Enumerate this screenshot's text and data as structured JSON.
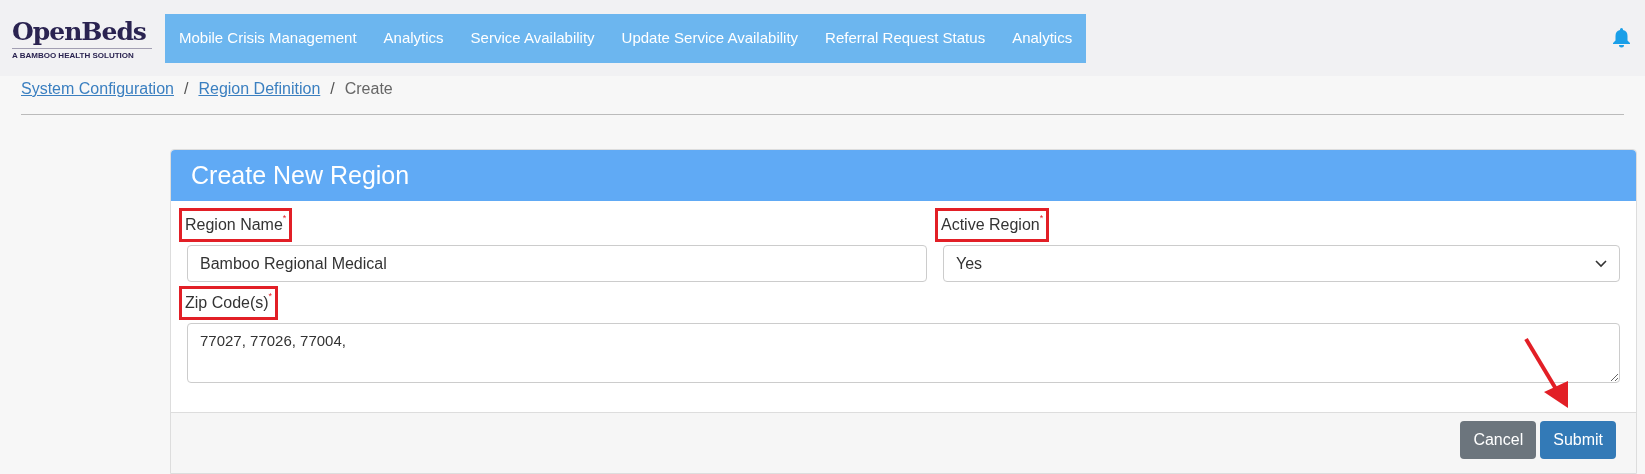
{
  "logo": {
    "name": "OpenBeds",
    "tagline": "A BAMBOO HEALTH SOLUTION"
  },
  "nav": [
    {
      "label": "Mobile Crisis Management"
    },
    {
      "label": "Analytics"
    },
    {
      "label": "Service Availability"
    },
    {
      "label": "Update Service Availability"
    },
    {
      "label": "Referral Request Status"
    },
    {
      "label": "Analytics"
    }
  ],
  "breadcrumb": [
    {
      "label": "System Configuration",
      "link": true
    },
    {
      "label": "Region Definition",
      "link": true
    },
    {
      "label": "Create",
      "link": false
    }
  ],
  "breadcrumb_separator": "/",
  "card": {
    "title": "Create New Region",
    "fields": [
      {
        "kind": "input",
        "label": "Region Name",
        "required_mark": "*",
        "value": "Bamboo Regional Medical",
        "highlighted": true
      },
      {
        "kind": "select",
        "label": "Active Region",
        "required_mark": "*",
        "value": "Yes",
        "highlighted": true
      },
      {
        "kind": "textarea",
        "label": "Zip Code(s)",
        "required_mark": "*",
        "value": "77027, 77026, 77004,",
        "highlighted": true
      }
    ],
    "buttons": [
      {
        "label": "Cancel",
        "kind": "secondary"
      },
      {
        "label": "Submit",
        "kind": "primary"
      }
    ]
  }
}
